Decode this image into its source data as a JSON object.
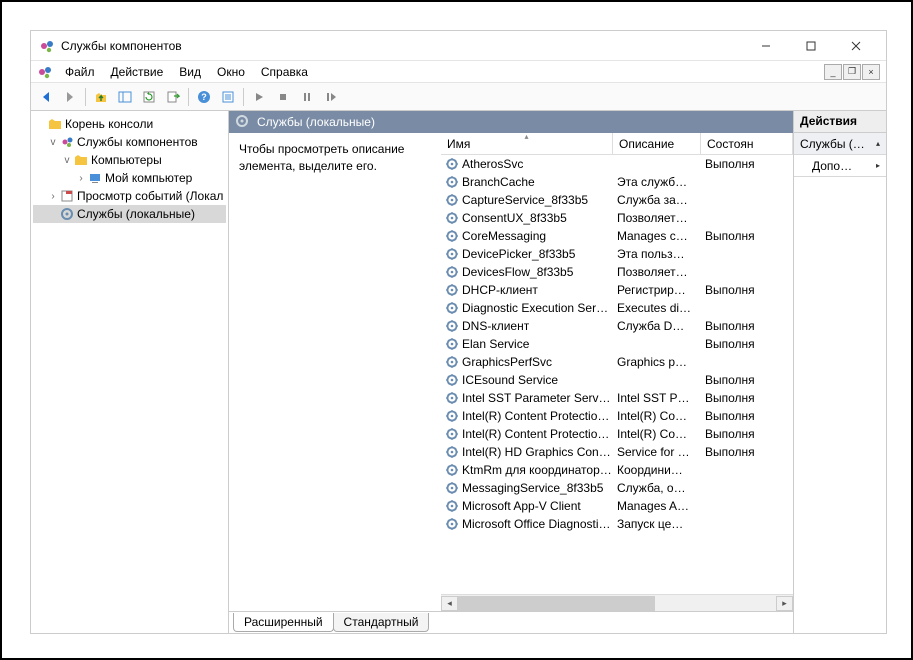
{
  "window": {
    "title": "Службы компонентов"
  },
  "menu": {
    "file": "Файл",
    "action": "Действие",
    "view": "Вид",
    "window": "Окно",
    "help": "Справка"
  },
  "tree": {
    "root": "Корень консоли",
    "comp_services": "Службы компонентов",
    "computers": "Компьютеры",
    "my_computer": "Мой компьютер",
    "event_viewer": "Просмотр событий (Локал",
    "services_local": "Службы (локальные)"
  },
  "center": {
    "header": "Службы (локальные)",
    "description": "Чтобы просмотреть описание элемента, выделите его.",
    "columns": {
      "name": "Имя",
      "desc": "Описание",
      "status": "Состоян"
    }
  },
  "services": [
    {
      "name": "AtherosSvc",
      "desc": "",
      "status": "Выполня"
    },
    {
      "name": "BranchCache",
      "desc": "Эта служб…",
      "status": ""
    },
    {
      "name": "CaptureService_8f33b5",
      "desc": "Служба за…",
      "status": ""
    },
    {
      "name": "ConsentUX_8f33b5",
      "desc": "Позволяет…",
      "status": ""
    },
    {
      "name": "CoreMessaging",
      "desc": "Manages c…",
      "status": "Выполня"
    },
    {
      "name": "DevicePicker_8f33b5",
      "desc": "Эта польз…",
      "status": ""
    },
    {
      "name": "DevicesFlow_8f33b5",
      "desc": "Позволяет…",
      "status": ""
    },
    {
      "name": "DHCP-клиент",
      "desc": "Регистрир…",
      "status": "Выполня"
    },
    {
      "name": "Diagnostic Execution Service",
      "desc": "Executes di…",
      "status": ""
    },
    {
      "name": "DNS-клиент",
      "desc": "Служба D…",
      "status": "Выполня"
    },
    {
      "name": "Elan Service",
      "desc": "",
      "status": "Выполня"
    },
    {
      "name": "GraphicsPerfSvc",
      "desc": "Graphics p…",
      "status": ""
    },
    {
      "name": "ICEsound Service",
      "desc": "",
      "status": "Выполня"
    },
    {
      "name": "Intel SST Parameter Service",
      "desc": "Intel SST P…",
      "status": "Выполня"
    },
    {
      "name": "Intel(R) Content Protection …",
      "desc": "Intel(R) Co…",
      "status": "Выполня"
    },
    {
      "name": "Intel(R) Content Protection …",
      "desc": "Intel(R) Co…",
      "status": "Выполня"
    },
    {
      "name": "Intel(R) HD Graphics Contro…",
      "desc": "Service for …",
      "status": "Выполня"
    },
    {
      "name": "KtmRm для координатора …",
      "desc": "Координи…",
      "status": ""
    },
    {
      "name": "MessagingService_8f33b5",
      "desc": "Служба, о…",
      "status": ""
    },
    {
      "name": "Microsoft App-V Client",
      "desc": "Manages A…",
      "status": ""
    },
    {
      "name": "Microsoft Office Diagnostic…",
      "desc": "Запуск це…",
      "status": ""
    }
  ],
  "tabs": {
    "extended": "Расширенный",
    "standard": "Стандартный"
  },
  "actions": {
    "header": "Действия",
    "services": "Службы (…",
    "more": "Допо…"
  }
}
